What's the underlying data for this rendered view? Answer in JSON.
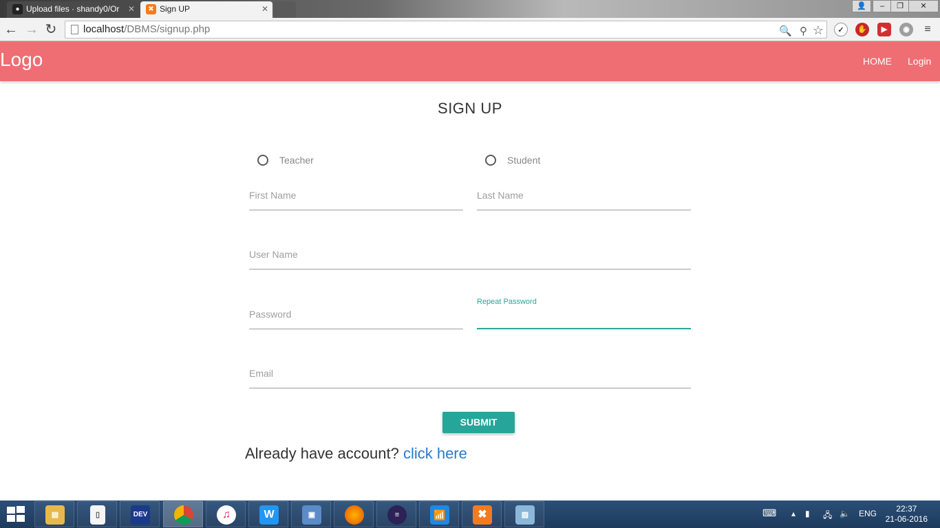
{
  "browser": {
    "tabs": [
      {
        "title": "Upload files · shandy0/Or",
        "icon": "github-icon"
      },
      {
        "title": "Sign UP",
        "icon": "xampp-icon"
      }
    ],
    "address": {
      "host": "localhost",
      "path": "/DBMS/signup.php"
    }
  },
  "navbar": {
    "logo": "Logo",
    "links": [
      "HOME",
      "Login"
    ],
    "color": "#ee6e73"
  },
  "form": {
    "title": "SIGN UP",
    "roles": [
      "Teacher",
      "Student"
    ],
    "fields": {
      "first_name": "First Name",
      "last_name": "Last Name",
      "user_name": "User Name",
      "password": "Password",
      "repeat_password": "Repeat Password",
      "email": "Email"
    },
    "submit": "SUBMIT",
    "accent": "#26a69a"
  },
  "footer": {
    "already_text": "Already have account?",
    "link_text": "click here"
  },
  "taskbar": {
    "apps": [
      "file-explorer-icon",
      "notepad-icon",
      "devcpp-icon",
      "chrome-icon",
      "itunes-icon",
      "wps-icon",
      "virtualbox-icon",
      "firefox-icon",
      "eclipse-icon",
      "wifi-manager-icon",
      "xampp-icon",
      "photos-icon"
    ],
    "lang": "ENG",
    "time": "22:37",
    "date": "21-06-2016"
  }
}
